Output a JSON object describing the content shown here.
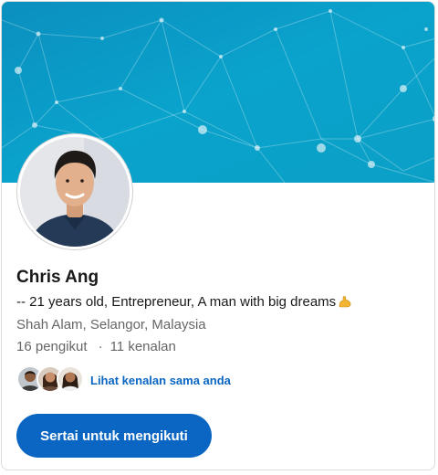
{
  "profile": {
    "name": "Chris Ang",
    "headline": "-- 21 years old, Entrepreneur, A man with big dreams",
    "headline_emoji_icon": "flexed-biceps-icon",
    "location": "Shah Alam, Selangor, Malaysia",
    "followers": "16 pengikut",
    "separator": "·",
    "connections": "11 kenalan"
  },
  "mutual": {
    "link_text": "Lihat kenalan sama anda"
  },
  "actions": {
    "follow_label": "Sertai untuk mengikuti"
  },
  "colors": {
    "banner": "#0aa3cc",
    "accent": "#0a66c2"
  }
}
